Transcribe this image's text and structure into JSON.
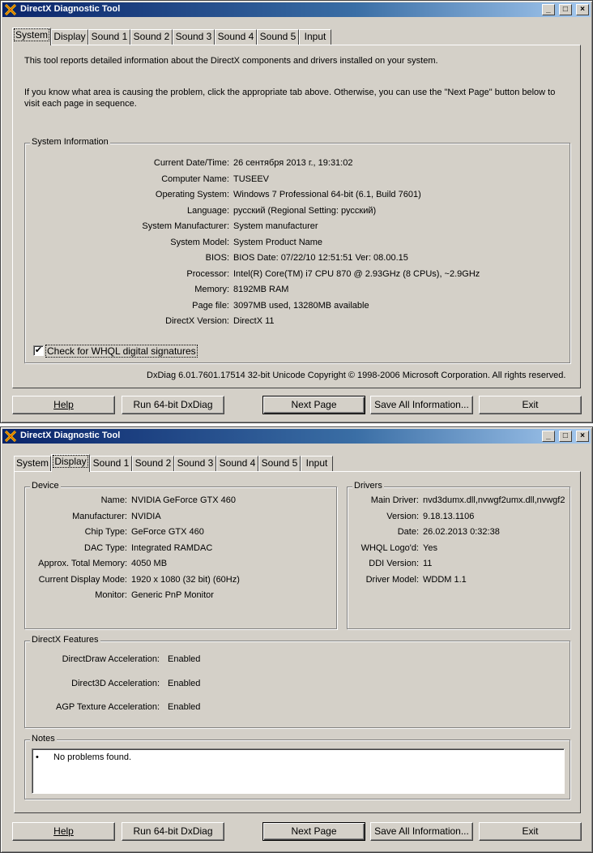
{
  "window1": {
    "title": "DirectX Diagnostic Tool",
    "titlebar_buttons": [
      "_",
      "□",
      "×"
    ],
    "tabs": [
      "System",
      "Display",
      "Sound 1",
      "Sound 2",
      "Sound 3",
      "Sound 4",
      "Sound 5",
      "Input"
    ],
    "active_tab": "System",
    "intro1": "This tool reports detailed information about the DirectX components and drivers installed on your system.",
    "intro2a": "If you know what area is causing the problem, click the appropriate tab above.  Otherwise, you can use the \"Next Page\" button below to",
    "intro2b": "visit each page in sequence.",
    "sysinfo": {
      "title": "System Information",
      "rows": [
        {
          "label": "Current Date/Time:",
          "value": "26 сентября 2013 г., 19:31:02"
        },
        {
          "label": "Computer Name:",
          "value": "TUSEEV"
        },
        {
          "label": "Operating System:",
          "value": "Windows 7 Professional 64-bit (6.1, Build 7601)"
        },
        {
          "label": "Language:",
          "value": "русский (Regional Setting: русский)"
        },
        {
          "label": "System Manufacturer:",
          "value": "System manufacturer"
        },
        {
          "label": "System Model:",
          "value": "System Product Name"
        },
        {
          "label": "BIOS:",
          "value": "BIOS Date: 07/22/10 12:51:51 Ver: 08.00.15"
        },
        {
          "label": "Processor:",
          "value": "Intel(R) Core(TM) i7 CPU       870  @ 2.93GHz (8 CPUs), ~2.9GHz"
        },
        {
          "label": "Memory:",
          "value": "8192MB RAM"
        },
        {
          "label": "Page file:",
          "value": "3097MB used, 13280MB available"
        },
        {
          "label": "DirectX Version:",
          "value": "DirectX 11"
        }
      ],
      "whql_label": "Check for WHQL digital signatures",
      "whql_mark": "✔"
    },
    "footer": "DxDiag 6.01.7601.17514 32-bit Unicode  Copyright © 1998-2006 Microsoft Corporation.  All rights reserved.",
    "buttons": [
      "Help",
      "Run 64-bit DxDiag",
      "Next Page",
      "Save All Information...",
      "Exit"
    ]
  },
  "window2": {
    "title": "DirectX Diagnostic Tool",
    "titlebar_buttons": [
      "_",
      "□",
      "×"
    ],
    "tabs": [
      "System",
      "Display",
      "Sound 1",
      "Sound 2",
      "Sound 3",
      "Sound 4",
      "Sound 5",
      "Input"
    ],
    "active_tab": "Display",
    "device": {
      "title": "Device",
      "rows": [
        {
          "label": "Name:",
          "value": "NVIDIA GeForce GTX 460"
        },
        {
          "label": "Manufacturer:",
          "value": "NVIDIA"
        },
        {
          "label": "Chip Type:",
          "value": "GeForce GTX 460"
        },
        {
          "label": "DAC Type:",
          "value": "Integrated RAMDAC"
        },
        {
          "label": "Approx. Total Memory:",
          "value": "4050 MB"
        },
        {
          "label": "Current Display Mode:",
          "value": "1920 x 1080 (32 bit) (60Hz)"
        },
        {
          "label": "Monitor:",
          "value": "Generic PnP Monitor"
        }
      ]
    },
    "drivers": {
      "title": "Drivers",
      "rows": [
        {
          "label": "Main Driver:",
          "value": "nvd3dumx.dll,nvwgf2umx.dll,nvwgf2"
        },
        {
          "label": "Version:",
          "value": "9.18.13.1106"
        },
        {
          "label": "Date:",
          "value": "26.02.2013 0:32:38"
        },
        {
          "label": "WHQL Logo'd:",
          "value": "Yes"
        },
        {
          "label": "DDI Version:",
          "value": "11"
        },
        {
          "label": "Driver Model:",
          "value": "WDDM 1.1"
        }
      ]
    },
    "features": {
      "title": "DirectX Features",
      "rows": [
        {
          "label": "DirectDraw Acceleration:",
          "value": "Enabled"
        },
        {
          "label": "Direct3D Acceleration:",
          "value": "Enabled"
        },
        {
          "label": "AGP Texture Acceleration:",
          "value": "Enabled"
        }
      ]
    },
    "notes": {
      "title": "Notes",
      "items": [
        "No problems found."
      ]
    },
    "buttons": [
      "Help",
      "Run 64-bit DxDiag",
      "Next Page",
      "Save All Information...",
      "Exit"
    ]
  },
  "colors": {
    "face": "#d4d0c8",
    "title_start": "#0a246a",
    "title_end": "#a6caf0"
  }
}
